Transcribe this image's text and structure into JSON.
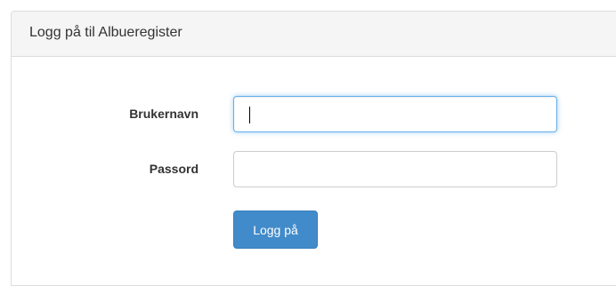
{
  "panel": {
    "title": "Logg på til Albueregister"
  },
  "form": {
    "username_label": "Brukernavn",
    "username_value": "",
    "password_label": "Passord",
    "password_value": "",
    "submit_label": "Logg på"
  },
  "colors": {
    "primary_button": "#428bca",
    "focus_border": "#66afe9",
    "heading_background": "#f5f5f5"
  }
}
